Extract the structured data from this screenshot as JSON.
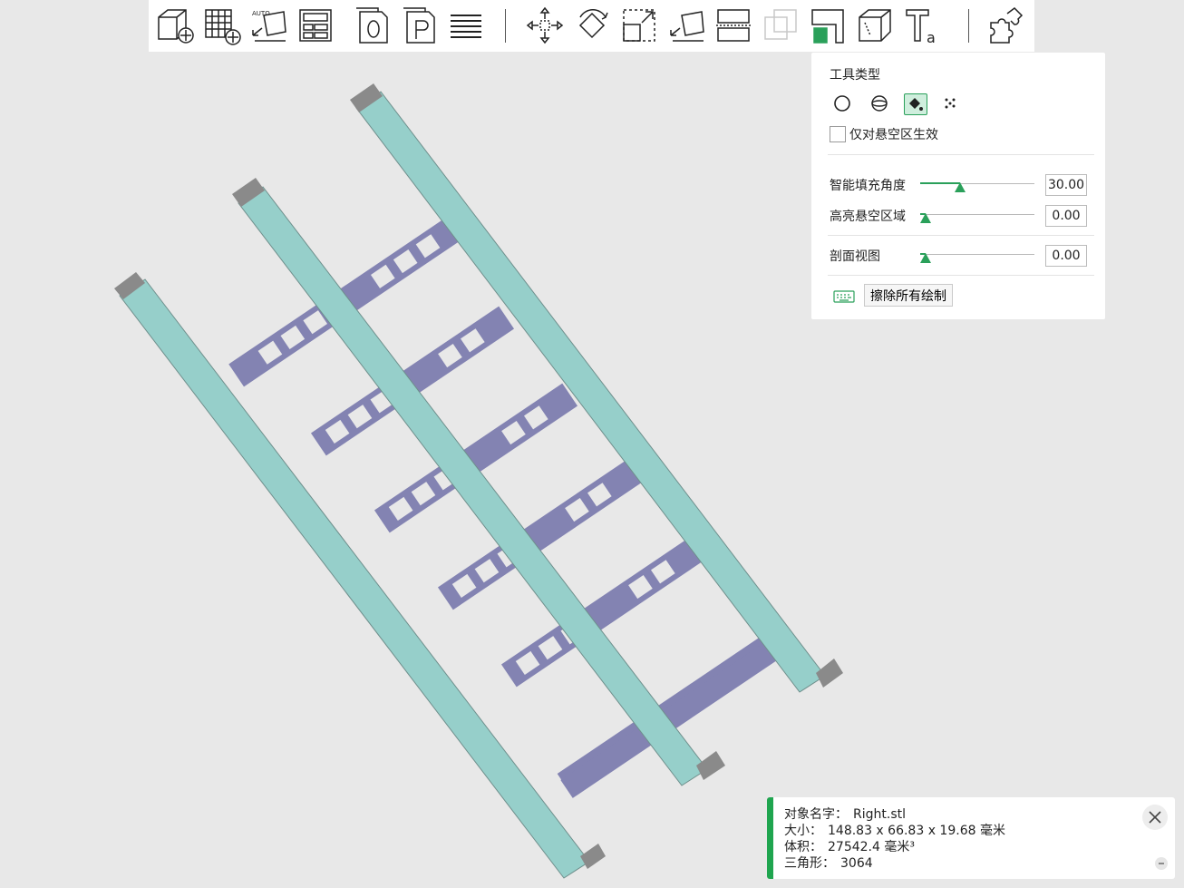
{
  "toolbar": {
    "buttons": [
      {
        "name": "add-object",
        "icon": "cube-plus-icon"
      },
      {
        "name": "add-array",
        "icon": "grid-plus-icon"
      },
      {
        "name": "auto-layout",
        "icon": "auto-place-icon",
        "badge": "AUTO"
      },
      {
        "name": "layout",
        "icon": "layout-icon"
      },
      {
        "name": "plate-o",
        "icon": "page-o-icon",
        "letter": "O"
      },
      {
        "name": "plate-p",
        "icon": "page-p-icon",
        "letter": "P"
      },
      {
        "name": "layers",
        "icon": "list-icon"
      },
      {
        "name": "move",
        "icon": "move-arrows-icon"
      },
      {
        "name": "rotate",
        "icon": "rotate-icon"
      },
      {
        "name": "scale",
        "icon": "scale-icon"
      },
      {
        "name": "place-face",
        "icon": "lay-flat-icon"
      },
      {
        "name": "cut",
        "icon": "cut-icon"
      },
      {
        "name": "boolean",
        "icon": "boolean-icon"
      },
      {
        "name": "support-paint",
        "icon": "support-paint-icon"
      },
      {
        "name": "hollow",
        "icon": "hollow-cube-icon"
      },
      {
        "name": "text",
        "icon": "text-emboss-icon",
        "letter": "T",
        "sub": "a"
      },
      {
        "name": "split",
        "icon": "puzzle-icon"
      }
    ]
  },
  "panel": {
    "title": "工具类型",
    "tool_types": [
      {
        "icon": "circle-brush-icon",
        "active": false
      },
      {
        "icon": "sphere-brush-icon",
        "active": false
      },
      {
        "icon": "fill-bucket-icon",
        "active": true
      },
      {
        "icon": "gap-fill-icon",
        "active": false
      }
    ],
    "overhang_only": {
      "label": "仅对悬空区生效",
      "checked": false
    },
    "sliders": [
      {
        "label": "智能填充角度",
        "value": "30.00",
        "level": 0.35
      },
      {
        "label": "高亮悬空区域",
        "value": "0.00",
        "level": 0.0
      },
      {
        "label": "剖面视图",
        "value": "0.00",
        "level": 0.0
      }
    ],
    "erase_label": "擦除所有绘制"
  },
  "info": {
    "name_key": "对象名字：",
    "name_val": "Right.stl",
    "size_key": "大小：",
    "size_val": "148.83 x 66.83 x 19.68 毫米",
    "volume_key": "体积：",
    "volume_val": "27542.4 毫米³",
    "tri_key": "三角形：",
    "tri_val": "3064"
  },
  "colors": {
    "background": "#e8e8e8",
    "rail": "#96cfca",
    "rung": "#8383b2",
    "accent": "#1fa54f"
  }
}
